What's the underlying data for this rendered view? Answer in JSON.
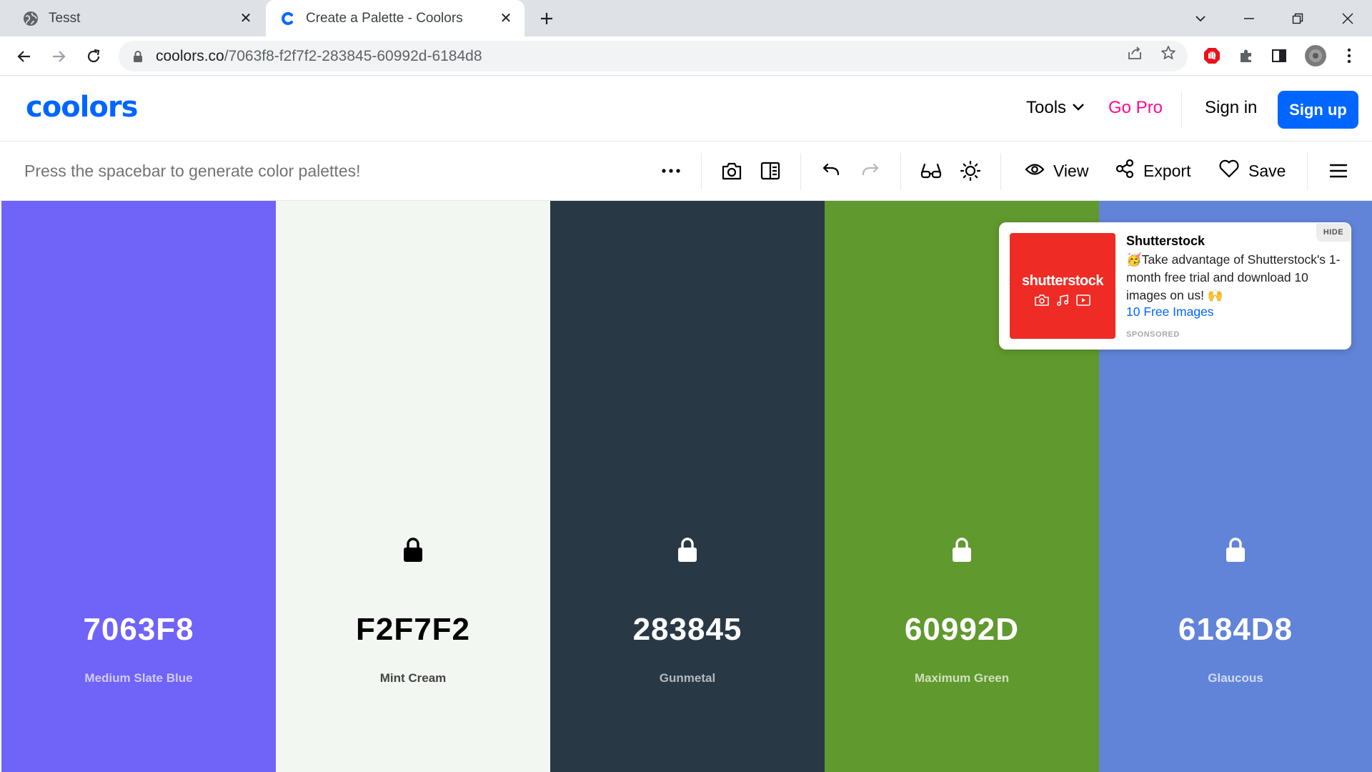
{
  "browser": {
    "tabs": [
      {
        "title": "Tesst",
        "icon": "globe-icon",
        "active": false
      },
      {
        "title": "Create a Palette - Coolors",
        "icon": "coolors-favicon",
        "active": true
      }
    ],
    "url_host": "coolors.co",
    "url_path": "/7063f8-f2f7f2-283845-60992d-6184d8"
  },
  "site": {
    "logo": "coolors",
    "nav": {
      "tools": "Tools",
      "go_pro": "Go Pro",
      "sign_in": "Sign in",
      "sign_up": "Sign up"
    }
  },
  "generator": {
    "hint": "Press the spacebar to generate color palettes!",
    "actions": {
      "view": "View",
      "export": "Export",
      "save": "Save"
    }
  },
  "palette": [
    {
      "hex": "7063F8",
      "name": "Medium Slate Blue",
      "bg": "#7063f8",
      "text": "#ffffff",
      "name_color": "#d0ccff",
      "lock_color": "#ffffff",
      "show_lock": false
    },
    {
      "hex": "F2F7F2",
      "name": "Mint Cream",
      "bg": "#f2f7f2",
      "text": "#000000",
      "name_color": "#444444",
      "lock_color": "#000000",
      "show_lock": true
    },
    {
      "hex": "283845",
      "name": "Gunmetal",
      "bg": "#283845",
      "text": "#ffffff",
      "name_color": "#b4b9be",
      "lock_color": "#ffffff",
      "show_lock": true
    },
    {
      "hex": "60992D",
      "name": "Maximum Green",
      "bg": "#60992d",
      "text": "#ffffff",
      "name_color": "#cfe1bf",
      "lock_color": "#ffffff",
      "show_lock": true
    },
    {
      "hex": "6184D8",
      "name": "Glaucous",
      "bg": "#6184d8",
      "text": "#ffffff",
      "name_color": "#d2dcf5",
      "lock_color": "#ffffff",
      "show_lock": true
    }
  ],
  "ad": {
    "title": "Shutterstock",
    "emoji_lead": "🥳",
    "body": "Take advantage of Shutterstock's 1-month free trial and download 10 images on us!",
    "emoji_tail": "🙌",
    "link": "10 Free Images",
    "sponsored": "SPONSORED",
    "hide": "HIDE",
    "brand_word": "shutterstock",
    "brand_color": "#ee2b24"
  }
}
